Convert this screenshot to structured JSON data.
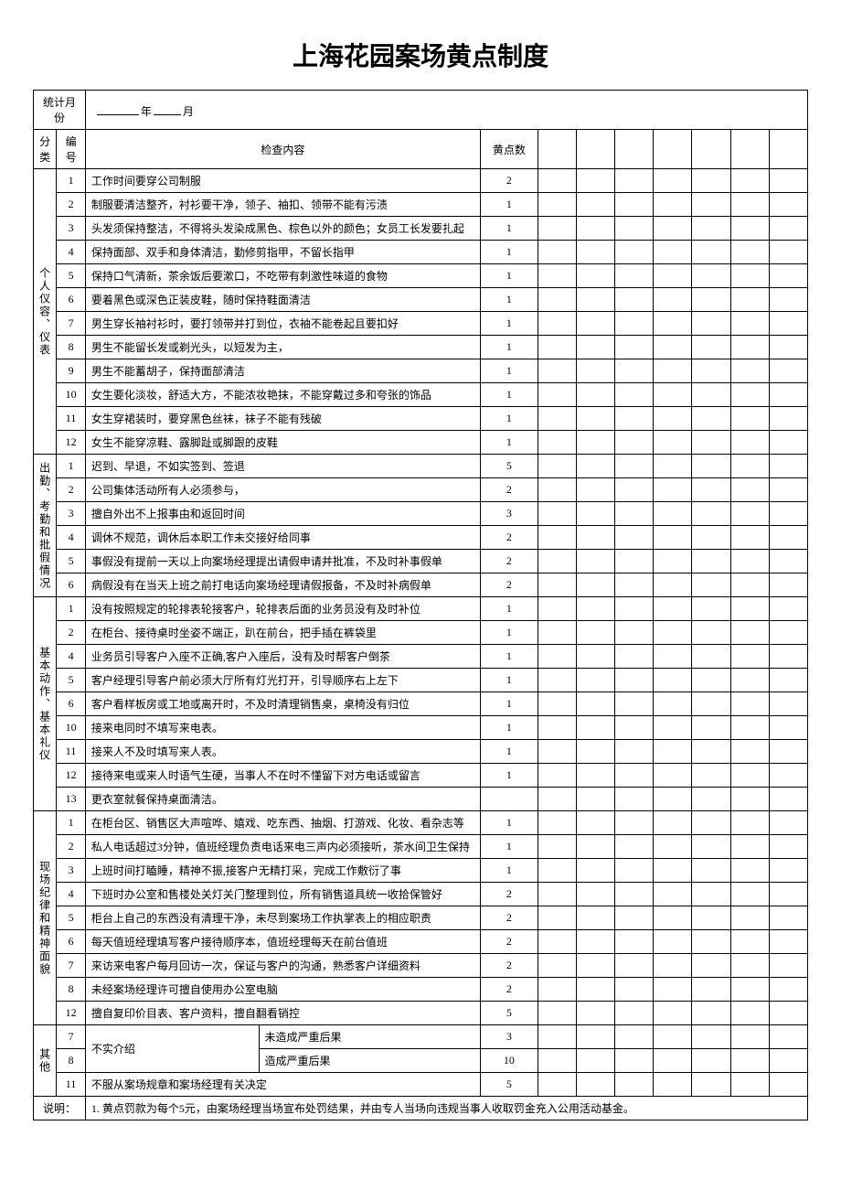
{
  "title": "上海花园案场黄点制度",
  "header": {
    "stat_month_label": "统计月份",
    "year_label": "年",
    "month_label": "月",
    "category_label": "分类",
    "number_label": "编号",
    "content_label": "检查内容",
    "points_label": "黄点数"
  },
  "sections": [
    {
      "category": "个人仪容、仪表",
      "rows": [
        {
          "num": "1",
          "desc": "工作时间要穿公司制服",
          "pts": "2"
        },
        {
          "num": "2",
          "desc": "制服要清洁整齐，衬衫要干净，领子、袖扣、领带不能有污渍",
          "pts": "1"
        },
        {
          "num": "3",
          "desc": "头发须保持整洁，不得将头发染成黑色、棕色以外的颜色；女员工长发要扎起",
          "pts": "1"
        },
        {
          "num": "4",
          "desc": "保持面部、双手和身体清洁，勤修剪指甲，不留长指甲",
          "pts": "1"
        },
        {
          "num": "5",
          "desc": "保持口气清新，茶余饭后要漱口，不吃带有刺激性味道的食物",
          "pts": "1"
        },
        {
          "num": "6",
          "desc": "要着黑色或深色正装皮鞋，随时保持鞋面清洁",
          "pts": "1"
        },
        {
          "num": "7",
          "desc": "男生穿长袖衬衫时，要打领带并打到位，衣袖不能卷起且要扣好",
          "pts": "1"
        },
        {
          "num": "8",
          "desc": "男生不能留长发或剃光头，以短发为主，",
          "pts": "1"
        },
        {
          "num": "9",
          "desc": "男生不能蓄胡子，保持面部清洁",
          "pts": "1"
        },
        {
          "num": "10",
          "desc": "女生要化淡妆，舒适大方，不能浓妆艳抹，不能穿戴过多和夸张的饰品",
          "pts": "1"
        },
        {
          "num": "11",
          "desc": "女生穿裙装时，要穿黑色丝袜，袜子不能有残破",
          "pts": "1"
        },
        {
          "num": "12",
          "desc": "女生不能穿凉鞋、露脚趾或脚跟的皮鞋",
          "pts": "1"
        }
      ]
    },
    {
      "category": "出勤、考勤和批假情况",
      "rows": [
        {
          "num": "1",
          "desc": "迟到、早退，不如实签到、签退",
          "pts": "5"
        },
        {
          "num": "2",
          "desc": "公司集体活动所有人必须参与，",
          "pts": "2"
        },
        {
          "num": "3",
          "desc": "擅自外出不上报事由和返回时间",
          "pts": "3"
        },
        {
          "num": "4",
          "desc": "调休不规范，调休后本职工作未交接好给同事",
          "pts": "2"
        },
        {
          "num": "5",
          "desc": "事假没有提前一天以上向案场经理提出请假申请并批准，不及时补事假单",
          "pts": "2"
        },
        {
          "num": "6",
          "desc": "病假没有在当天上班之前打电话向案场经理请假报备，不及时补病假单",
          "pts": "2"
        }
      ]
    },
    {
      "category": "基本动作、基本礼仪",
      "rows": [
        {
          "num": "1",
          "desc": "没有按照规定的轮排表轮接客户，轮排表后面的业务员没有及时补位",
          "pts": "1"
        },
        {
          "num": "2",
          "desc": "在柜台、接待桌时坐姿不端正，趴在前台，把手插在裤袋里",
          "pts": "1"
        },
        {
          "num": "4",
          "desc": "业务员引导客户入座不正确,客户入座后，没有及时帮客户倒茶",
          "pts": "1"
        },
        {
          "num": "5",
          "desc": "客户经理引导客户前必须大厅所有灯光打开，引导顺序右上左下",
          "pts": "1"
        },
        {
          "num": "6",
          "desc": "客户看样板房或工地或离开时，不及时清理销售桌，桌椅没有归位",
          "pts": "1"
        },
        {
          "num": "10",
          "desc": "接来电同时不填写来电表。",
          "pts": "1"
        },
        {
          "num": "11",
          "desc": "接来人不及时填写来人表。",
          "pts": "1"
        },
        {
          "num": "12",
          "desc": "接待来电或来人时语气生硬，当事人不在时不懂留下对方电话或留言",
          "pts": "1"
        },
        {
          "num": "13",
          "desc": "更衣室就餐保持桌面清洁。",
          "pts": ""
        }
      ]
    },
    {
      "category": "现场纪律和精神面貌",
      "rows": [
        {
          "num": "1",
          "desc": "在柜台区、销售区大声喧哗、嬉戏、吃东西、抽烟、打游戏、化妆、看杂志等",
          "pts": "1"
        },
        {
          "num": "2",
          "desc": "私人电话超过3分钟，值班经理负责电话来电三声内必须接听，茶水间卫生保持",
          "pts": "1"
        },
        {
          "num": "3",
          "desc": "上班时间打瞌睡，精神不振,接客户无精打采，完成工作敷衍了事",
          "pts": "1"
        },
        {
          "num": "4",
          "desc": "下班时办公室和售楼处关灯关门整理到位，所有销售道具统一收拾保管好",
          "pts": "2"
        },
        {
          "num": "5",
          "desc": "柜台上自己的东西没有清理干净，未尽到案场工作执掌表上的相应职责",
          "pts": "2"
        },
        {
          "num": "6",
          "desc": "每天值班经理填写客户接待顺序本，值班经理每天在前台值班",
          "pts": "2"
        },
        {
          "num": "7",
          "desc": "来访来电客户每月回访一次，保证与客户的沟通，熟悉客户详细资料",
          "pts": "2"
        },
        {
          "num": "8",
          "desc": "未经案场经理许可擅自使用办公室电脑",
          "pts": "2"
        },
        {
          "num": "12",
          "desc": "擅自复印价目表、客户资料，擅自翻看销控",
          "pts": "5"
        }
      ]
    },
    {
      "category": "其他",
      "split": {
        "left_label": "不实介绍",
        "rows": [
          {
            "num": "7",
            "right": "未造成严重后果",
            "pts": "3"
          },
          {
            "num": "8",
            "right": "造成严重后果",
            "pts": "10"
          }
        ]
      },
      "tail": [
        {
          "num": "11",
          "desc": "不服从案场规章和案场经理有关决定",
          "pts": "5"
        }
      ]
    }
  ],
  "note": {
    "label": "说明：",
    "text": "1. 黄点罚款为每个5元，由案场经理当场宣布处罚结果，并由专人当场向违规当事人收取罚金充入公用活动基金。"
  }
}
